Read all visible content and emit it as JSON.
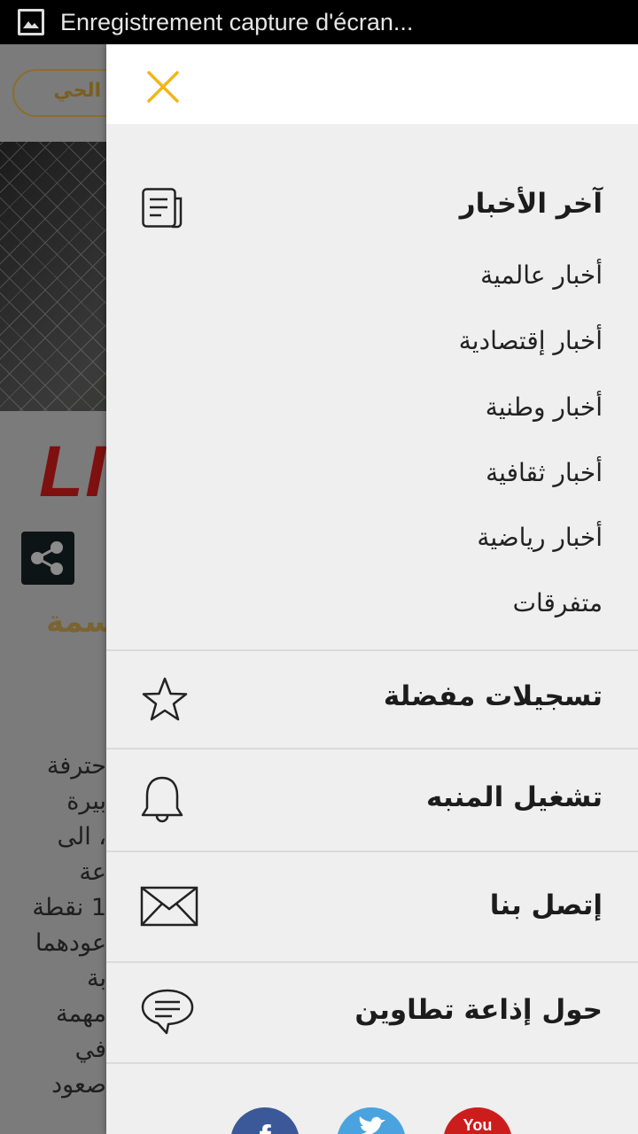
{
  "status_bar": {
    "notification_text": "Enregistrement capture d'écran..."
  },
  "background": {
    "live_button_label": "ث الحي",
    "logo_text": "LI",
    "headline_fragment": "سمة",
    "article_lines": [
      "حترفة",
      "بيرة",
      "، الى",
      "عة",
      "1 نقطة",
      "عودهما",
      "بة",
      "مهمة",
      "في",
      "صعود"
    ]
  },
  "drawer": {
    "latest_news": {
      "title": "آخر الأخبار",
      "items": [
        "أخبار عالمية",
        "أخبار إقتصادية",
        "أخبار وطنية",
        "أخبار ثقافية",
        "أخبار رياضية",
        "متفرقات"
      ]
    },
    "favorites_label": "تسجيلات مفضلة",
    "alarm_label": "تشغيل المنبه",
    "contact_label": "إتصل بنا",
    "about_label": "حول إذاعة تطاوين",
    "social": {
      "facebook": "f",
      "youtube": "You"
    }
  },
  "colors": {
    "accent": "#f2b51b",
    "drawer_bg": "#efefef",
    "dim_bg": "#7b7b7b"
  }
}
